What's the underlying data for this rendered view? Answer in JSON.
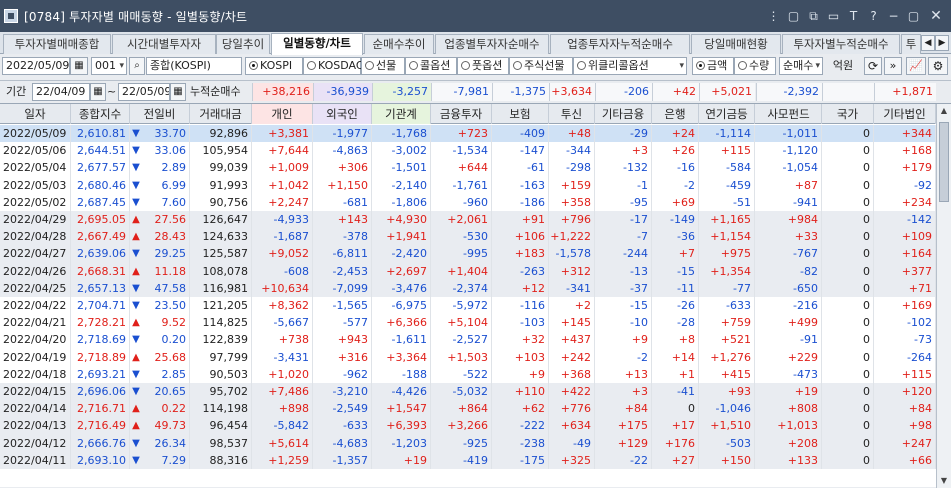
{
  "window": {
    "title": "[0784] 투자자별 매매동향 - 일별동향/차트",
    "controls": [
      "⋮",
      "▢",
      "⧉",
      "▭",
      "T",
      "?",
      "−",
      "▢",
      "✕"
    ]
  },
  "tabs": [
    "투자자별매매종합",
    "시간대별투자자",
    "당일추이",
    "일별동향/차트",
    "순매수추이",
    "업종별투자자순매수",
    "업종투자자누적순매수",
    "당일매매현황",
    "투자자별누적순매수",
    "투"
  ],
  "active_tab": 3,
  "controls": {
    "date": "2022/05/09",
    "code": "001",
    "market_name": "종합(KOSPI)",
    "markets": [
      "KOSPI",
      "KOSDAQ",
      "선물",
      "콜옵션",
      "풋옵션",
      "주식선물"
    ],
    "selected_market": "KOSPI",
    "option_select": "위클리콜옵션",
    "value_types": [
      "금액",
      "수량"
    ],
    "selected_value_type": "금액",
    "metric_select": "순매수",
    "unit": "억원"
  },
  "period": {
    "label": "기간",
    "from": "22/04/09",
    "to": "22/05/09",
    "sum_label": "누적순매수",
    "sums": [
      "+38,216",
      "-36,939",
      "-3,257",
      "-7,981",
      "-1,375",
      "+3,634",
      "-206",
      "+42",
      "+5,021",
      "-2,392",
      "",
      "+1,871"
    ]
  },
  "table": {
    "headers": [
      "일자",
      "종합지수",
      "전일비",
      "거래대금",
      "개인",
      "외국인",
      "기관계",
      "금융투자",
      "보험",
      "투신",
      "기타금융",
      "은행",
      "연기금등",
      "사모펀드",
      "국가",
      "기타법인"
    ],
    "rows": [
      [
        "2022/05/09",
        "2,610.81",
        "down",
        "33.70",
        "92,896",
        "+3,381",
        "-1,977",
        "-1,768",
        "+723",
        "-409",
        "+48",
        "-29",
        "+24",
        "-1,114",
        "-1,011",
        "0",
        "+344"
      ],
      [
        "2022/05/06",
        "2,644.51",
        "down",
        "33.06",
        "105,954",
        "+7,644",
        "-4,863",
        "-3,002",
        "-1,534",
        "-147",
        "-344",
        "+3",
        "+26",
        "+115",
        "-1,120",
        "0",
        "+168"
      ],
      [
        "2022/05/04",
        "2,677.57",
        "down",
        "2.89",
        "99,039",
        "+1,009",
        "+306",
        "-1,501",
        "+644",
        "-61",
        "-298",
        "-132",
        "-16",
        "-584",
        "-1,054",
        "0",
        "+179"
      ],
      [
        "2022/05/03",
        "2,680.46",
        "down",
        "6.99",
        "91,993",
        "+1,042",
        "+1,150",
        "-2,140",
        "-1,761",
        "-163",
        "+159",
        "-1",
        "-2",
        "-459",
        "+87",
        "0",
        "-92"
      ],
      [
        "2022/05/02",
        "2,687.45",
        "down",
        "7.60",
        "90,756",
        "+2,247",
        "-681",
        "-1,806",
        "-960",
        "-186",
        "+358",
        "-95",
        "+69",
        "-51",
        "-941",
        "0",
        "+234"
      ],
      [
        "2022/04/29",
        "2,695.05",
        "up",
        "27.56",
        "126,647",
        "-4,933",
        "+143",
        "+4,930",
        "+2,061",
        "+91",
        "+796",
        "-17",
        "-149",
        "+1,165",
        "+984",
        "0",
        "-142"
      ],
      [
        "2022/04/28",
        "2,667.49",
        "up",
        "28.43",
        "124,633",
        "-1,687",
        "-378",
        "+1,941",
        "-530",
        "+106",
        "+1,222",
        "-7",
        "-36",
        "+1,154",
        "+33",
        "0",
        "+109"
      ],
      [
        "2022/04/27",
        "2,639.06",
        "down",
        "29.25",
        "125,587",
        "+9,052",
        "-6,811",
        "-2,420",
        "-995",
        "+183",
        "-1,578",
        "-244",
        "+7",
        "+975",
        "-767",
        "0",
        "+164"
      ],
      [
        "2022/04/26",
        "2,668.31",
        "up",
        "11.18",
        "108,078",
        "-608",
        "-2,453",
        "+2,697",
        "+1,404",
        "-263",
        "+312",
        "-13",
        "-15",
        "+1,354",
        "-82",
        "0",
        "+377"
      ],
      [
        "2022/04/25",
        "2,657.13",
        "down",
        "47.58",
        "116,981",
        "+10,634",
        "-7,099",
        "-3,476",
        "-2,374",
        "+12",
        "-341",
        "-37",
        "-11",
        "-77",
        "-650",
        "0",
        "+71"
      ],
      [
        "2022/04/22",
        "2,704.71",
        "down",
        "23.50",
        "121,205",
        "+8,362",
        "-1,565",
        "-6,975",
        "-5,972",
        "-116",
        "+2",
        "-15",
        "-26",
        "-633",
        "-216",
        "0",
        "+169"
      ],
      [
        "2022/04/21",
        "2,728.21",
        "up",
        "9.52",
        "114,825",
        "-5,667",
        "-577",
        "+6,366",
        "+5,104",
        "-103",
        "+145",
        "-10",
        "-28",
        "+759",
        "+499",
        "0",
        "-102"
      ],
      [
        "2022/04/20",
        "2,718.69",
        "down",
        "0.20",
        "122,839",
        "+738",
        "+943",
        "-1,611",
        "-2,527",
        "+32",
        "+437",
        "+9",
        "+8",
        "+521",
        "-91",
        "0",
        "-73"
      ],
      [
        "2022/04/19",
        "2,718.89",
        "up",
        "25.68",
        "97,799",
        "-3,431",
        "+316",
        "+3,364",
        "+1,503",
        "+103",
        "+242",
        "-2",
        "+14",
        "+1,276",
        "+229",
        "0",
        "-264"
      ],
      [
        "2022/04/18",
        "2,693.21",
        "down",
        "2.85",
        "90,503",
        "+1,020",
        "-962",
        "-188",
        "-522",
        "+9",
        "+368",
        "+13",
        "+1",
        "+415",
        "-473",
        "0",
        "+115"
      ],
      [
        "2022/04/15",
        "2,696.06",
        "down",
        "20.65",
        "95,702",
        "+7,486",
        "-3,210",
        "-4,426",
        "-5,032",
        "+110",
        "+422",
        "+3",
        "-41",
        "+93",
        "+19",
        "0",
        "+120"
      ],
      [
        "2022/04/14",
        "2,716.71",
        "up",
        "0.22",
        "114,198",
        "+898",
        "-2,549",
        "+1,547",
        "+864",
        "+62",
        "+776",
        "+84",
        "0",
        "-1,046",
        "+808",
        "0",
        "+84"
      ],
      [
        "2022/04/13",
        "2,716.49",
        "up",
        "49.73",
        "96,454",
        "-5,842",
        "-633",
        "+6,393",
        "+3,266",
        "-222",
        "+634",
        "+175",
        "+17",
        "+1,510",
        "+1,013",
        "0",
        "+98"
      ],
      [
        "2022/04/12",
        "2,666.76",
        "down",
        "26.34",
        "98,537",
        "+5,614",
        "-4,683",
        "-1,203",
        "-925",
        "-238",
        "-49",
        "+129",
        "+176",
        "-503",
        "+208",
        "0",
        "+247"
      ],
      [
        "2022/04/11",
        "2,693.10",
        "down",
        "7.29",
        "88,316",
        "+1,259",
        "-1,357",
        "+19",
        "-419",
        "-175",
        "+325",
        "-22",
        "+27",
        "+150",
        "+133",
        "0",
        "+66"
      ]
    ]
  },
  "colors": {
    "titlebar": "#3e4e63",
    "positive": "#e0201a",
    "negative": "#1a4fd0",
    "row_band": "#e9ecf1",
    "row_selected": "#cfe1f5",
    "col_personal": "#fde4e4",
    "col_foreign": "#e9e2f6",
    "col_institution": "#e6f4dd"
  }
}
